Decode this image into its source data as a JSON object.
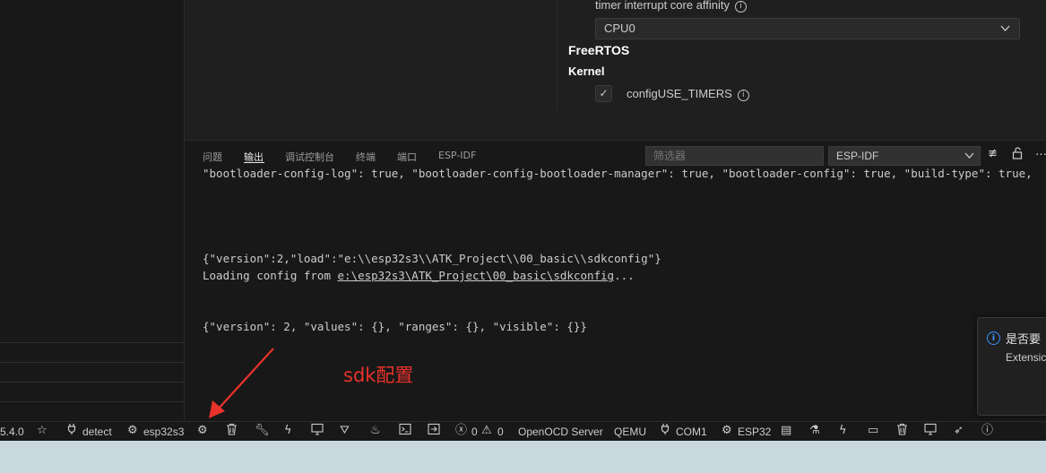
{
  "config_editor": {
    "affinity_label": "timer interrupt core affinity",
    "affinity_value": "CPU0",
    "section_title": "FreeRTOS",
    "subsection_title": "Kernel",
    "timers_label": "configUSE_TIMERS",
    "timers_checked": true
  },
  "panel": {
    "tabs": [
      "问题",
      "输出",
      "调试控制台",
      "终端",
      "端口",
      "ESP-IDF"
    ],
    "active_tab": "输出",
    "filter_placeholder": "筛选器",
    "channel": "ESP-IDF",
    "output_lines": {
      "line1": "\"bootloader-config-log\": true, \"bootloader-config-bootloader-manager\": true, \"bootloader-config\": true, \"build-type\": true,",
      "line2": "{\"version\":2,\"load\":\"e:\\\\esp32s3\\\\ATK_Project\\\\00_basic\\\\sdkconfig\"}",
      "line3_prefix": "Loading config from ",
      "line3_link": "e:\\esp32s3\\ATK_Project\\00_basic\\sdkconfig",
      "line3_suffix": "...",
      "line4": "{\"version\": 2, \"values\": {}, \"ranges\": {}, \"visible\": {}}"
    }
  },
  "annotation": {
    "text": "sdk配置",
    "color": "#e8322a"
  },
  "notification": {
    "title": "是否要",
    "body": "Extensic"
  },
  "status_bar": {
    "version": "5.4.0",
    "detect": "detect",
    "target": "esp32s3",
    "errors": "0",
    "warnings": "0",
    "openocd": "OpenOCD Server",
    "qemu": "QEMU",
    "port": "COM1",
    "chip": "ESP32"
  }
}
